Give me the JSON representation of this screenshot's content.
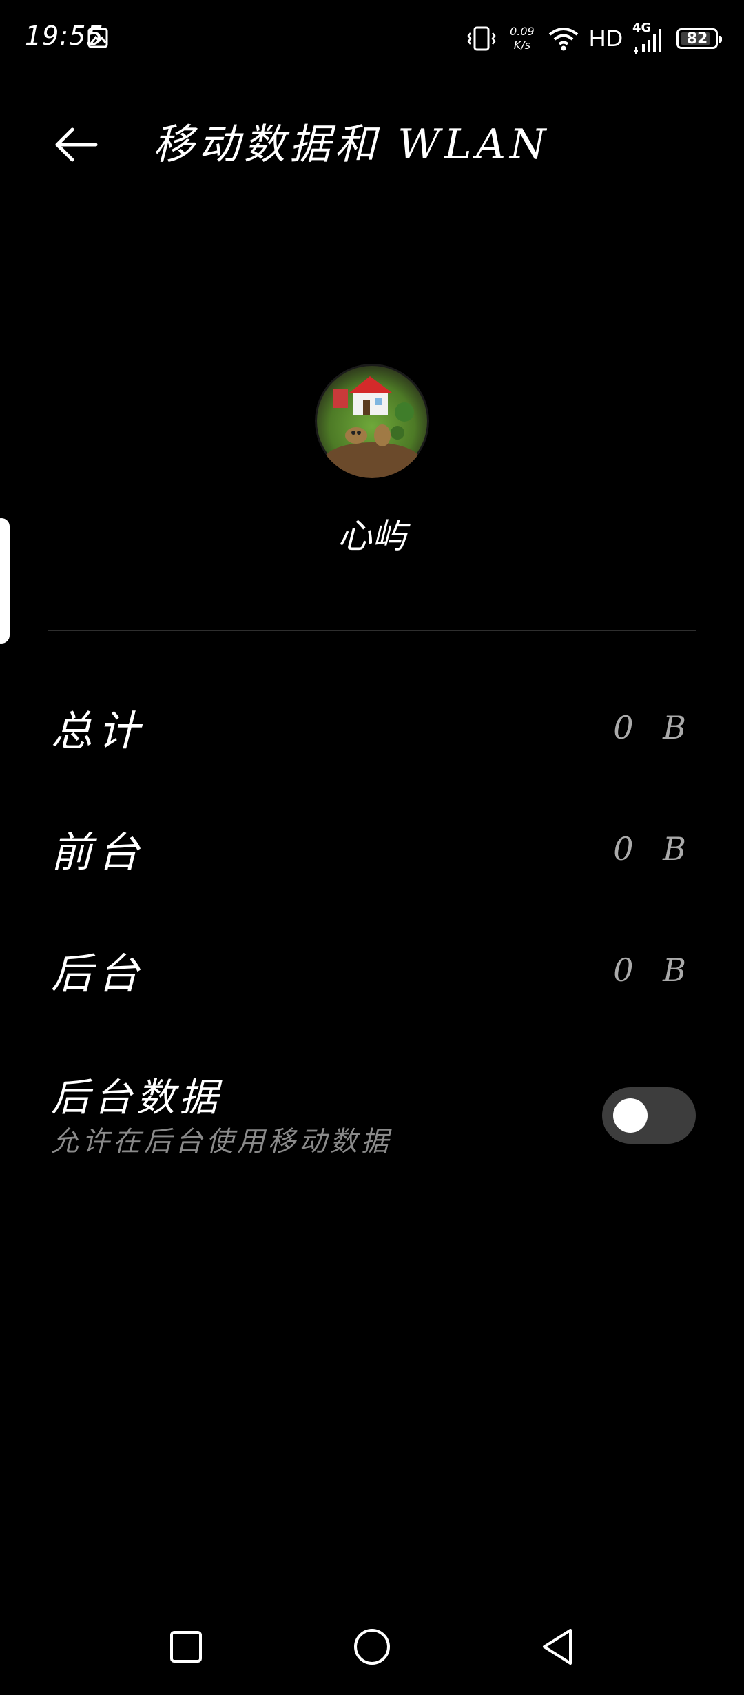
{
  "status_bar": {
    "time": "19:55",
    "net_speed_value": "0.09",
    "net_speed_unit": "K/s",
    "network_label": "HD",
    "cell_type": "4G",
    "battery_level": "82"
  },
  "header": {
    "title": "移动数据和 WLAN"
  },
  "app": {
    "name": "心屿"
  },
  "stats": [
    {
      "label": "总计",
      "value": "0 B"
    },
    {
      "label": "前台",
      "value": "0 B"
    },
    {
      "label": "后台",
      "value": "0 B"
    }
  ],
  "background_data": {
    "title": "后台数据",
    "subtitle": "允许在后台使用移动数据",
    "enabled": false
  },
  "colors": {
    "background": "#000000",
    "toggle_off": "#3d3d3d",
    "secondary_text": "#8a8a8a"
  }
}
